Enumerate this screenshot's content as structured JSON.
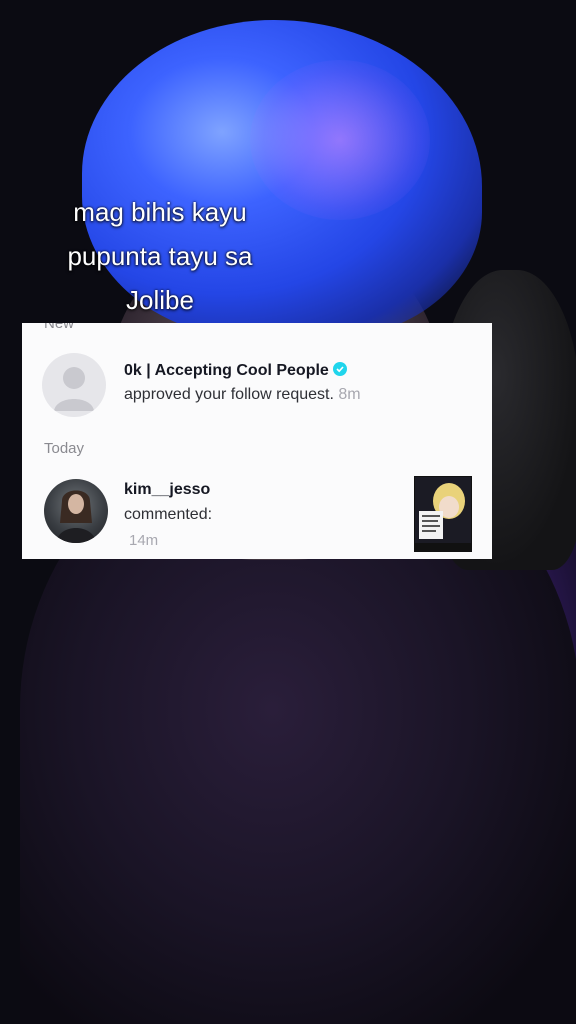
{
  "video": {
    "caption_lines": [
      "mag bihis kayu",
      "pupunta tayu sa",
      "Jolibe"
    ]
  },
  "notifications": {
    "section_new_label": "New",
    "section_today_label": "Today",
    "items": [
      {
        "username": "0k | Accepting Cool People",
        "verified": true,
        "action": "approved your follow request.",
        "time": "8m",
        "avatar_icon": "default-avatar-icon"
      },
      {
        "username": "kim__jesso",
        "action": "commented:",
        "time": "14m",
        "avatar_icon": "profile-photo",
        "thumbnail_icon": "video-thumbnail"
      }
    ]
  },
  "colors": {
    "verified": "#20d5ec",
    "card_bg": "#fbfbfc",
    "hair_blue": "#2f5bff"
  }
}
